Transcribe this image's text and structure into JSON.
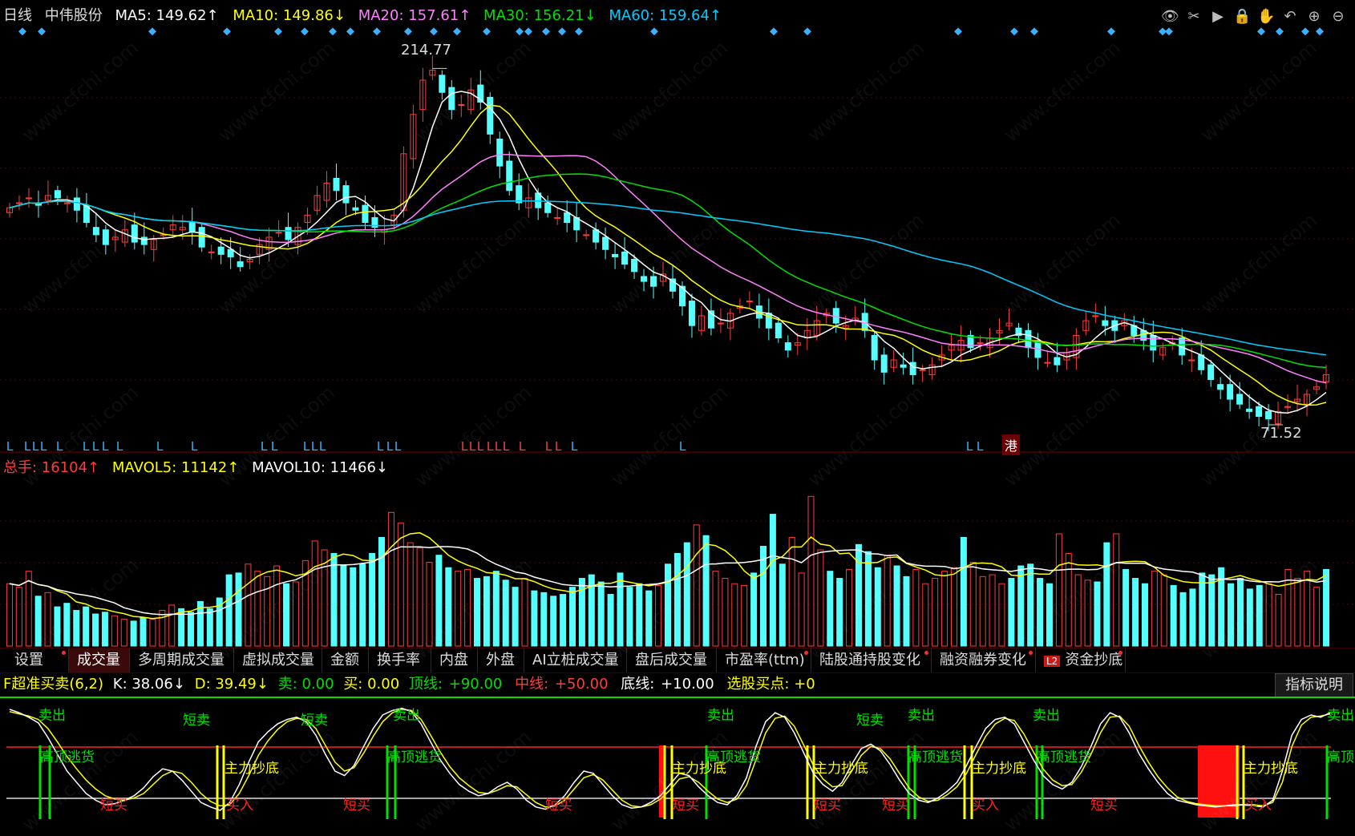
{
  "colors": {
    "up": "#ff3b3b",
    "down": "#54ffff",
    "ma5": "#ffffff",
    "ma10": "#ffff00",
    "ma20": "#ff80ff",
    "ma30": "#00e000",
    "ma60": "#00ccff",
    "vol_ma5": "#ffff00",
    "vol_ma10": "#ffffff",
    "k": "#ffffff",
    "d": "#ffff00",
    "grid": "#550000"
  },
  "header": {
    "period": "日线",
    "stock_name": "中伟股份",
    "ma5": "MA5: 149.62↑",
    "ma10": "MA10: 149.86↓",
    "ma20": "MA20: 157.61↑",
    "ma30": "MA30: 156.21↓",
    "ma60": "MA60: 159.64↑"
  },
  "toolbar_icons": [
    "eye-icon",
    "scissors-icon",
    "play-icon",
    "lock-icon",
    "hand-icon",
    "undo-icon",
    "zoom-in-icon",
    "zoom-out-icon"
  ],
  "price_marks": {
    "high": "214.77",
    "low": "71.52",
    "hk_badge": "港"
  },
  "volume_header": {
    "total": "总手: 16104↑",
    "mavol5": "MAVOL5: 11142↑",
    "mavol10": "MAVOL10: 11466↓"
  },
  "tabs": [
    {
      "label": "设置",
      "dot": true
    },
    {
      "label": "成交量",
      "dot": false,
      "active": true
    },
    {
      "label": "多周期成交量",
      "dot": false
    },
    {
      "label": "虚拟成交量",
      "dot": false
    },
    {
      "label": "金额",
      "dot": false
    },
    {
      "label": "换手率",
      "dot": false
    },
    {
      "label": "内盘",
      "dot": false
    },
    {
      "label": "外盘",
      "dot": false
    },
    {
      "label": "AI立桩成交量",
      "dot": false
    },
    {
      "label": "盘后成交量",
      "dot": false
    },
    {
      "label": "市盈率(ttm)",
      "dot": true
    },
    {
      "label": "陆股通持股变化",
      "dot": true
    },
    {
      "label": "融资融券变化",
      "dot": true
    },
    {
      "label": "资金抄底",
      "dot": true,
      "badge": "L2"
    }
  ],
  "indicator_header": {
    "name": "F超准买卖(6,2)",
    "k": "K: 38.06↓",
    "d": "D: 39.49↓",
    "sell": "卖: 0.00",
    "buy": "买: 0.00",
    "top_label": "顶线:",
    "top_val": "+90.00",
    "mid_label": "中线:",
    "mid_val": "+50.00",
    "bottom_label": "底线:",
    "bottom_val": "+10.00",
    "pick": "选股买点: +0"
  },
  "explain_button": "指标说明",
  "watermark": "www.cfchi.com",
  "signals": {
    "short_sell": "短卖",
    "short_buy": "短买",
    "sell_out": "卖出",
    "top_escape": "高顶逃货",
    "bottom_buy": "主力抄底",
    "buy": "买入",
    "top": "高顶"
  },
  "chart_data": [
    {
      "type": "candlestick",
      "title": "中伟股份 日线",
      "ylim": [
        65,
        225
      ],
      "high_mark": 214.77,
      "low_mark": 71.52,
      "series_names": [
        "MA5",
        "MA10",
        "MA20",
        "MA30",
        "MA60"
      ],
      "close": [
        158,
        160,
        162,
        159,
        163,
        162,
        160,
        157,
        152,
        147,
        143,
        146,
        149,
        144,
        143,
        145,
        147,
        151,
        150,
        148,
        142,
        140,
        139,
        138,
        134,
        137,
        143,
        146,
        148,
        145,
        150,
        155,
        163,
        168,
        165,
        160,
        157,
        152,
        150,
        149,
        155,
        180,
        196,
        210,
        214,
        205,
        198,
        200,
        206,
        201,
        188,
        175,
        165,
        160,
        162,
        158,
        156,
        154,
        152,
        149,
        147,
        144,
        141,
        138,
        135,
        132,
        128,
        126,
        131,
        124,
        118,
        110,
        114,
        109,
        111,
        115,
        118,
        120,
        113,
        109,
        105,
        100,
        103,
        108,
        112,
        115,
        111,
        110,
        113,
        108,
        96,
        91,
        96,
        93,
        90,
        92,
        94,
        98,
        102,
        104,
        101,
        103,
        105,
        108,
        111,
        106,
        101,
        97,
        95,
        94,
        99,
        106,
        112,
        114,
        110,
        108,
        112,
        106,
        104,
        100,
        101,
        103,
        98,
        96,
        92,
        88,
        84,
        80,
        78,
        75,
        73,
        72,
        75,
        77,
        80,
        82,
        85,
        90
      ],
      "ylabel": ""
    },
    {
      "type": "bar",
      "title": "成交量",
      "series_names": [
        "VOL",
        "MAVOL5",
        "MAVOL10"
      ],
      "values": [
        35,
        33,
        42,
        28,
        30,
        22,
        24,
        20,
        22,
        18,
        19,
        17,
        15,
        14,
        16,
        15,
        20,
        23,
        21,
        19,
        25,
        21,
        27,
        40,
        41,
        46,
        42,
        39,
        45,
        35,
        36,
        48,
        59,
        54,
        52,
        45,
        44,
        46,
        52,
        61,
        75,
        69,
        58,
        55,
        47,
        51,
        44,
        42,
        43,
        38,
        39,
        42,
        37,
        33,
        38,
        31,
        30,
        28,
        29,
        33,
        38,
        40,
        36,
        29,
        41,
        33,
        35,
        31,
        34,
        46,
        52,
        58,
        68,
        62,
        42,
        38,
        35,
        34,
        41,
        56,
        74,
        46,
        61,
        41,
        84,
        54,
        42,
        38,
        43,
        57,
        53,
        44,
        51,
        45,
        39,
        43,
        35,
        38,
        42,
        44,
        61,
        47,
        39,
        40,
        35,
        38,
        45,
        46,
        38,
        35,
        63,
        52,
        40,
        37,
        36,
        58,
        63,
        43,
        38,
        35,
        42,
        40,
        34,
        30,
        32,
        41,
        40,
        44,
        35,
        38,
        32,
        34,
        35,
        29,
        43,
        38,
        42,
        33,
        43
      ],
      "ylim": [
        0,
        90
      ]
    },
    {
      "type": "line",
      "title": "F超准买卖(6,2)",
      "series_names": [
        "K",
        "D"
      ],
      "ylim": [
        0,
        100
      ],
      "k": [
        95,
        92,
        88,
        83,
        70,
        55,
        40,
        30,
        20,
        14,
        10,
        11,
        14,
        18,
        25,
        35,
        42,
        40,
        32,
        22,
        12,
        8,
        5,
        12,
        28,
        48,
        66,
        75,
        82,
        86,
        88,
        84,
        72,
        55,
        40,
        36,
        45,
        62,
        78,
        90,
        94,
        96,
        93,
        82,
        66,
        50,
        38,
        28,
        22,
        18,
        20,
        26,
        30,
        24,
        14,
        8,
        6,
        10,
        18,
        30,
        40,
        38,
        28,
        18,
        10,
        7,
        8,
        12,
        18,
        28,
        38,
        36,
        26,
        18,
        12,
        10,
        18,
        34,
        62,
        84,
        92,
        88,
        74,
        56,
        38,
        28,
        22,
        30,
        46,
        60,
        64,
        58,
        46,
        32,
        20,
        14,
        12,
        16,
        22,
        30,
        45,
        62,
        78,
        86,
        88,
        82,
        66,
        50,
        36,
        28,
        24,
        30,
        44,
        62,
        82,
        92,
        88,
        74,
        56,
        42,
        30,
        20,
        14,
        12,
        10,
        9,
        8,
        9,
        10,
        10,
        9,
        8,
        14,
        40,
        72,
        86,
        90,
        88,
        92
      ],
      "d": [
        93,
        91,
        89,
        86,
        78,
        66,
        53,
        42,
        32,
        24,
        18,
        15,
        14,
        16,
        20,
        28,
        36,
        40,
        38,
        30,
        20,
        13,
        9,
        10,
        20,
        36,
        54,
        67,
        77,
        84,
        87,
        86,
        78,
        63,
        48,
        40,
        43,
        56,
        71,
        84,
        92,
        95,
        94,
        86,
        72,
        57,
        44,
        34,
        27,
        21,
        20,
        23,
        27,
        26,
        19,
        12,
        8,
        9,
        14,
        24,
        34,
        37,
        32,
        23,
        14,
        9,
        8,
        10,
        15,
        23,
        33,
        35,
        30,
        22,
        15,
        12,
        15,
        27,
        50,
        74,
        87,
        89,
        80,
        63,
        45,
        33,
        26,
        27,
        40,
        54,
        62,
        60,
        51,
        38,
        25,
        17,
        13,
        14,
        19,
        26,
        38,
        55,
        71,
        82,
        87,
        85,
        73,
        57,
        42,
        32,
        27,
        28,
        39,
        55,
        74,
        88,
        89,
        80,
        63,
        48,
        35,
        25,
        17,
        13,
        11,
        10,
        9,
        9,
        9,
        10,
        10,
        9,
        12,
        30,
        62,
        81,
        88,
        89,
        91
      ]
    }
  ]
}
